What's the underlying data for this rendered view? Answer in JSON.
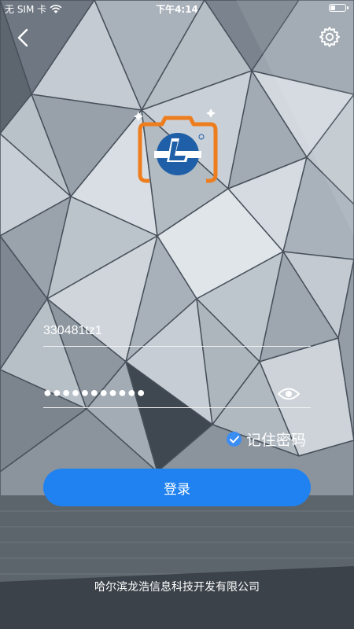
{
  "status_bar": {
    "carrier": "无 SIM 卡",
    "time": "下午4:14",
    "battery_level": 0.35
  },
  "nav": {
    "back_icon": "back-chevron-icon",
    "settings_icon": "gear-icon"
  },
  "logo": {
    "icon": "camera-el-logo-icon",
    "colors": {
      "frame": "#ee7d1e",
      "circle": "#1f5fa8"
    }
  },
  "form": {
    "username_value": "330481tz1",
    "password_value": "●●●●●●●●●●●",
    "password_toggle_icon": "eye-icon",
    "remember_label": "记住密码",
    "remember_checked": true,
    "login_label": "登录"
  },
  "footer": {
    "company": "哈尔滨龙浩信息科技开发有限公司"
  },
  "colors": {
    "accent": "#1f82f0",
    "checkbox": "#3b8df2"
  }
}
